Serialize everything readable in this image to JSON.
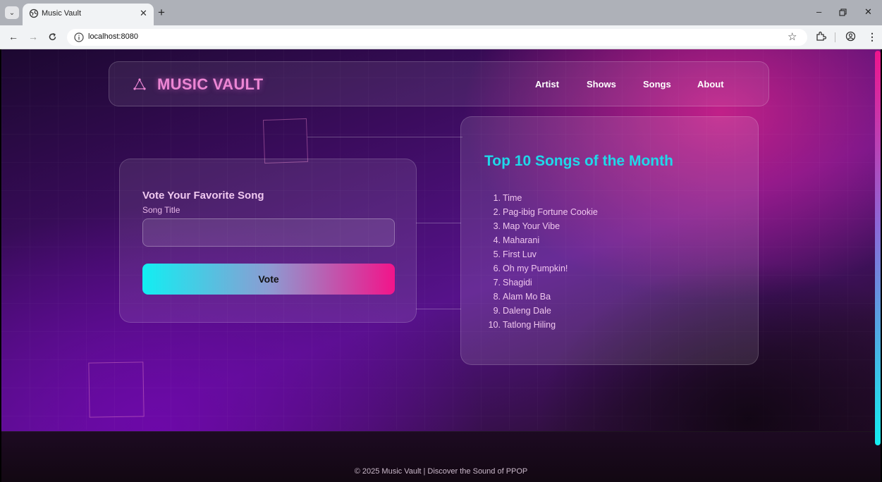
{
  "browser": {
    "tab_title": "Music Vault",
    "url": "localhost:8080"
  },
  "navbar": {
    "logo_text": "MUSIC VAULT",
    "links": [
      "Artist",
      "Shows",
      "Songs",
      "About"
    ]
  },
  "vote_form": {
    "title": "Vote Your Favorite Song",
    "field_label": "Song Title",
    "field_value": "",
    "button_label": "Vote"
  },
  "top_songs": {
    "title": "Top 10 Songs of the Month",
    "songs": [
      {
        "rank": "1.",
        "title": "Time"
      },
      {
        "rank": "2.",
        "title": "Pag-ibig Fortune Cookie"
      },
      {
        "rank": "3.",
        "title": "Map Your Vibe"
      },
      {
        "rank": "4.",
        "title": "Maharani"
      },
      {
        "rank": "5.",
        "title": "First Luv"
      },
      {
        "rank": "6.",
        "title": "Oh my Pumpkin!"
      },
      {
        "rank": "7.",
        "title": "Shagidi"
      },
      {
        "rank": "8.",
        "title": "Alam Mo Ba"
      },
      {
        "rank": "9.",
        "title": "Daleng Dale"
      },
      {
        "rank": "10.",
        "title": "Tatlong Hiling"
      }
    ]
  },
  "footer": {
    "text": "© 2025 Music Vault | Discover the Sound of PPOP"
  },
  "colors": {
    "accent_cyan": "#1fd8ea",
    "accent_pink": "#ec86d4",
    "button_gradient_start": "#12eef2",
    "button_gradient_end": "#f2148a"
  }
}
